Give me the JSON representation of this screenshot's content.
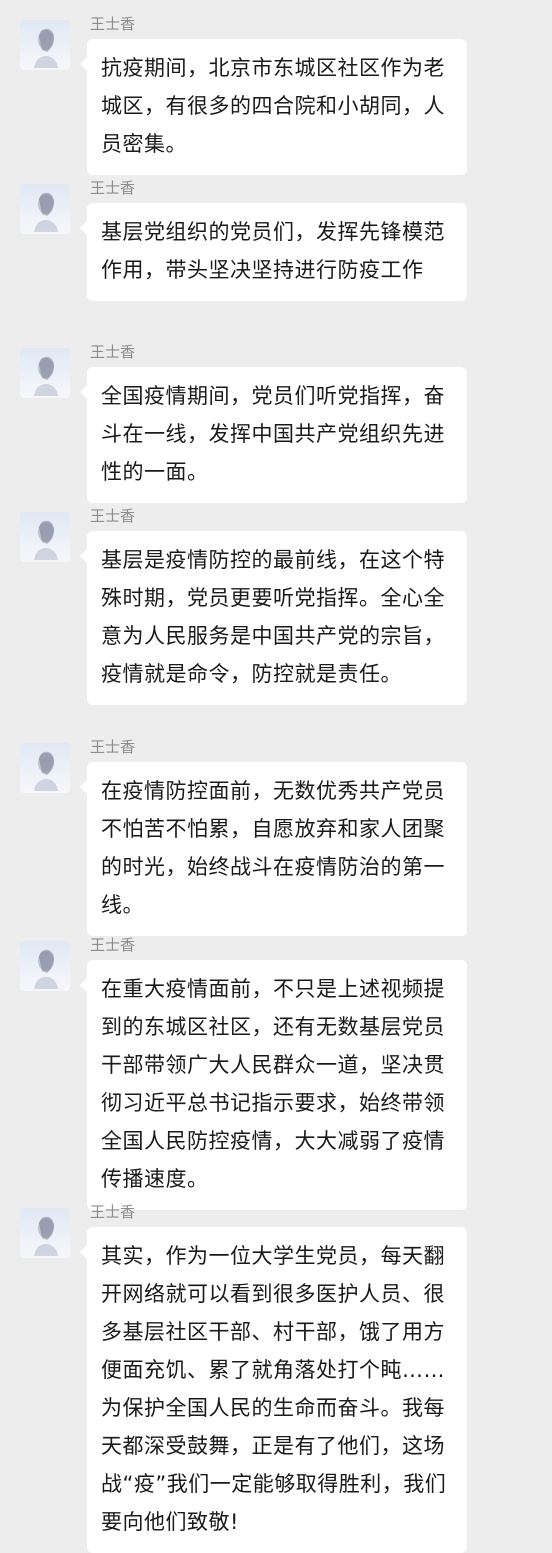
{
  "messages": [
    {
      "sender": "王士香",
      "text": "抗疫期间，北京市东城区社区作为老城区，有很多的四合院和小胡同，人员密集。"
    },
    {
      "sender": "王士香",
      "text": "基层党组织的党员们，发挥先锋模范作用，带头坚决坚持进行防疫工作"
    },
    {
      "sender": "王士香",
      "text": "全国疫情期间，党员们听党指挥，奋斗在一线，发挥中国共产党组织先进性的一面。"
    },
    {
      "sender": "王士香",
      "text": "基层是疫情防控的最前线，在这个特殊时期，党员更要听党指挥。全心全意为人民服务是中国共产党的宗旨，疫情就是命令，防控就是责任。"
    },
    {
      "sender": "王士香",
      "text": "在疫情防控面前，无数优秀共产党员不怕苦不怕累，自愿放弃和家人团聚的时光，始终战斗在疫情防治的第一线。"
    },
    {
      "sender": "王士香",
      "text": "在重大疫情面前，不只是上述视频提到的东城区社区，还有无数基层党员干部带领广大人民群众一道，坚决贯彻习近平总书记指示要求，始终带领全国人民防控疫情，大大减弱了疫情传播速度。"
    },
    {
      "sender": "王士香",
      "text": "其实，作为一位大学生党员，每天翻开网络就可以看到很多医护人员、很多基层社区干部、村干部，饿了用方便面充饥、累了就角落处打个盹……为保护全国人民的生命而奋斗。我每天都深受鼓舞，正是有了他们，这场战“疫”我们一定能够取得胜利，我们要向他们致敬!"
    }
  ]
}
